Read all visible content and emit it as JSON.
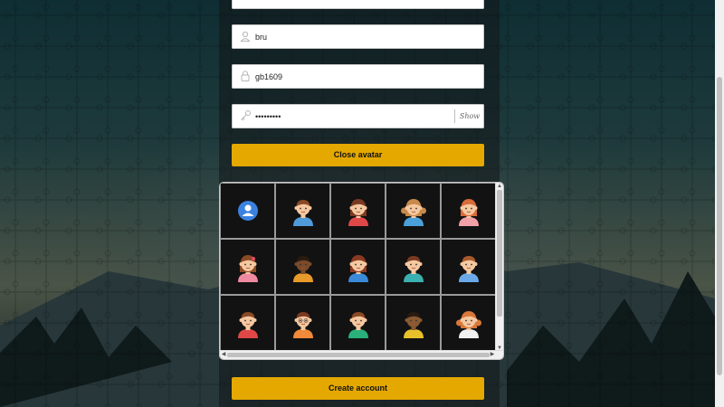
{
  "form": {
    "first_field_value": "",
    "username_value": "bru",
    "code_value": "gb1609",
    "password_value": "•••••••••",
    "show_label": "Show"
  },
  "buttons": {
    "close_avatar": "Close avatar",
    "create_account": "Create account"
  },
  "avatars": [
    {
      "name": "default-user-icon",
      "kind": "default"
    },
    {
      "name": "boy-brown-hair-blue-shirt",
      "skin": "#f5c8a0",
      "hair": "#8a4a25",
      "shirt": "#4f9ad9"
    },
    {
      "name": "girl-brown-hair-red-shirt",
      "skin": "#f5c8a0",
      "hair": "#7a3a22",
      "shirt": "#e04848"
    },
    {
      "name": "girl-pigtails-blue-shirt",
      "skin": "#f5c8a0",
      "hair": "#c78a4a",
      "shirt": "#4aa0d8"
    },
    {
      "name": "girl-orange-hair-pink-shirt",
      "skin": "#f5c8a0",
      "hair": "#d96b3a",
      "shirt": "#f1a0a8"
    },
    {
      "name": "girl-brown-bow-pink-shirt",
      "skin": "#f5c8a0",
      "hair": "#8a4a25",
      "shirt": "#f08aa0"
    },
    {
      "name": "boy-dark-skin-orange-shirt",
      "skin": "#7a4a2a",
      "hair": "#2a1a10",
      "shirt": "#e89a2a"
    },
    {
      "name": "girl-brown-hair-blue-shirt",
      "skin": "#f5c8a0",
      "hair": "#8a3a22",
      "shirt": "#3a8ad8"
    },
    {
      "name": "boy-brown-hair-teal-shirt",
      "skin": "#f5c8a0",
      "hair": "#7a3a22",
      "shirt": "#3ab0b0"
    },
    {
      "name": "boy-light-brown-hair-blue-shirt",
      "skin": "#f5c8a0",
      "hair": "#a85a2a",
      "shirt": "#6aa8e8"
    },
    {
      "name": "boy-brown-hair-red-shirt",
      "skin": "#f5c8a0",
      "hair": "#8a4a25",
      "shirt": "#e04848"
    },
    {
      "name": "boy-glasses-orange-shirt",
      "skin": "#f5c8a0",
      "hair": "#7a3a22",
      "shirt": "#f08a3a"
    },
    {
      "name": "boy-brown-hair-green-shirt",
      "skin": "#f5c8a0",
      "hair": "#8a4a25",
      "shirt": "#2ab07a"
    },
    {
      "name": "boy-dark-skin-yellow-shirt",
      "skin": "#8a5a32",
      "hair": "#2a1a10",
      "shirt": "#e8c02a"
    },
    {
      "name": "girl-orange-pigtails-white-shirt",
      "skin": "#f5c8a0",
      "hair": "#d9783a",
      "shirt": "#f0f0f0"
    }
  ],
  "colors": {
    "accent": "#e4a800",
    "default_avatar": "#3b82e0"
  }
}
